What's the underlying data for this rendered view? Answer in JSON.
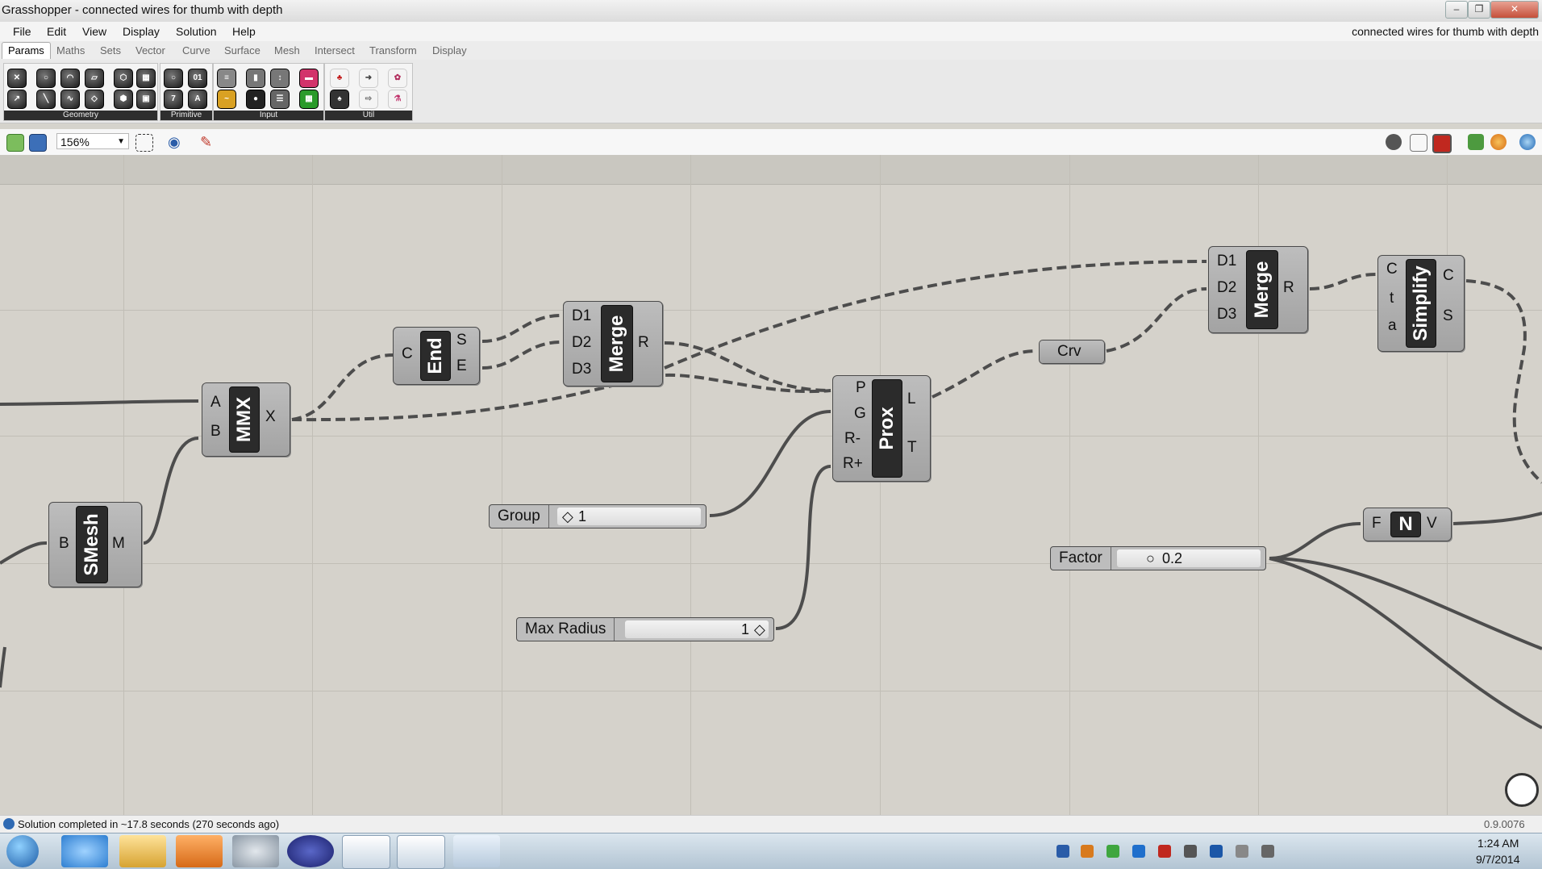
{
  "window": {
    "title": "Grasshopper - connected wires for thumb with depth"
  },
  "menu": {
    "items": [
      "File",
      "Edit",
      "View",
      "Display",
      "Solution",
      "Help"
    ],
    "doc_title": "connected wires for thumb with depth"
  },
  "tabs": {
    "items": [
      "Params",
      "Maths",
      "Sets",
      "Vector",
      "Curve",
      "Surface",
      "Mesh",
      "Intersect",
      "Transform",
      "Display"
    ],
    "active": "Params"
  },
  "ribbon": {
    "panels": [
      "Geometry",
      "Primitive",
      "Input",
      "Util"
    ]
  },
  "toolbar": {
    "zoom": "156%"
  },
  "components": {
    "smesh": {
      "name": "SMesh",
      "inputs": [
        "B"
      ],
      "outputs": [
        "M"
      ]
    },
    "mmx": {
      "name": "MMX",
      "inputs": [
        "A",
        "B"
      ],
      "outputs": [
        "X"
      ]
    },
    "end": {
      "name": "End",
      "inputs": [
        "C"
      ],
      "outputs": [
        "S",
        "E"
      ]
    },
    "merge1": {
      "name": "Merge",
      "inputs": [
        "D1",
        "D2",
        "D3"
      ],
      "outputs": [
        "R"
      ]
    },
    "prox": {
      "name": "Prox",
      "inputs": [
        "P",
        "G",
        "R-",
        "R+"
      ],
      "outputs": [
        "L",
        "T"
      ]
    },
    "crv": {
      "name": "Crv"
    },
    "merge2": {
      "name": "Merge",
      "inputs": [
        "D1",
        "D2",
        "D3"
      ],
      "outputs": [
        "R"
      ]
    },
    "simplify": {
      "name": "Simplify",
      "inputs": [
        "C",
        "t",
        "a"
      ],
      "outputs": [
        "C",
        "S"
      ]
    },
    "unit": {
      "name": "N",
      "inputs": [
        "F"
      ],
      "outputs": [
        "V"
      ]
    }
  },
  "sliders": {
    "group": {
      "label": "Group",
      "value": "1"
    },
    "maxradius": {
      "label": "Max Radius",
      "value": "1"
    },
    "factor": {
      "label": "Factor",
      "value": "0.2"
    }
  },
  "status": {
    "message": "Solution completed in ~17.8 seconds (270 seconds ago)",
    "version": "0.9.0076"
  },
  "clock": {
    "time": "1:24 AM",
    "date": "9/7/2014"
  },
  "colors": {
    "canvas": "#d5d2cb",
    "wire": "#4d4d4d",
    "component": "#b1b1b1",
    "core": "#2b2b2b"
  }
}
